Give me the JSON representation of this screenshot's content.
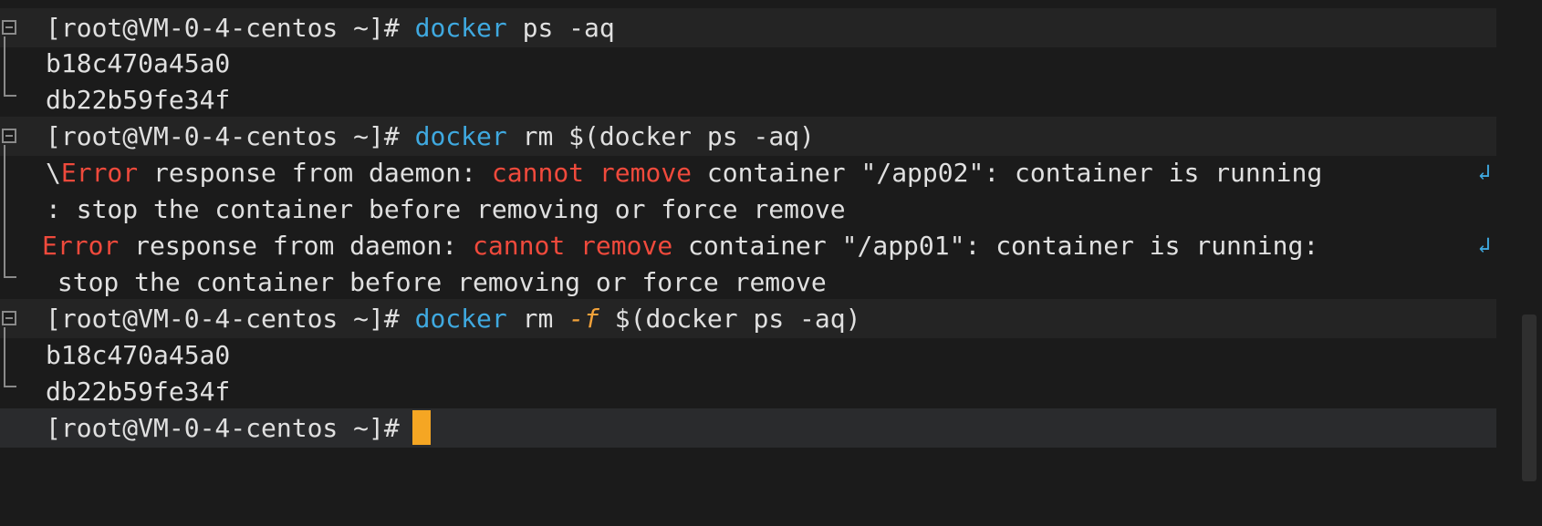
{
  "prompt": "[root@VM-0-4-centos ~]#",
  "blocks": [
    {
      "cmd_name": "docker",
      "cmd_args": " ps -aq",
      "output": [
        "b18c470a45a0",
        "db22b59fe34f"
      ]
    },
    {
      "cmd_name": "docker",
      "cmd_args": " rm $(docker ps -aq)"
    },
    {
      "cmd_name": "docker",
      "cmd_rm": " rm ",
      "cmd_flag": "-f",
      "cmd_rest": " $(docker ps -aq)",
      "output": [
        "b18c470a45a0",
        "db22b59fe34f"
      ]
    }
  ],
  "errors": {
    "e1_prefix": "\\",
    "e1_error": "Error",
    "e1_mid": " response from daemon: ",
    "e1_cannot": "cannot remove",
    "e1_rest": " container \"/app02\": container is running",
    "e1_cont": ": stop the container before removing or force remove",
    "e2_error": "Error",
    "e2_mid": " response from daemon: ",
    "e2_cannot": "cannot remove",
    "e2_rest": " container \"/app01\": container is running:",
    "e2_cont": " stop the container before removing or force remove"
  },
  "wrap_glyph": "↲",
  "colors": {
    "accent": "#3fa9e0",
    "error": "#f04a3c",
    "cursor": "#f5a623",
    "background": "#1b1b1b"
  }
}
